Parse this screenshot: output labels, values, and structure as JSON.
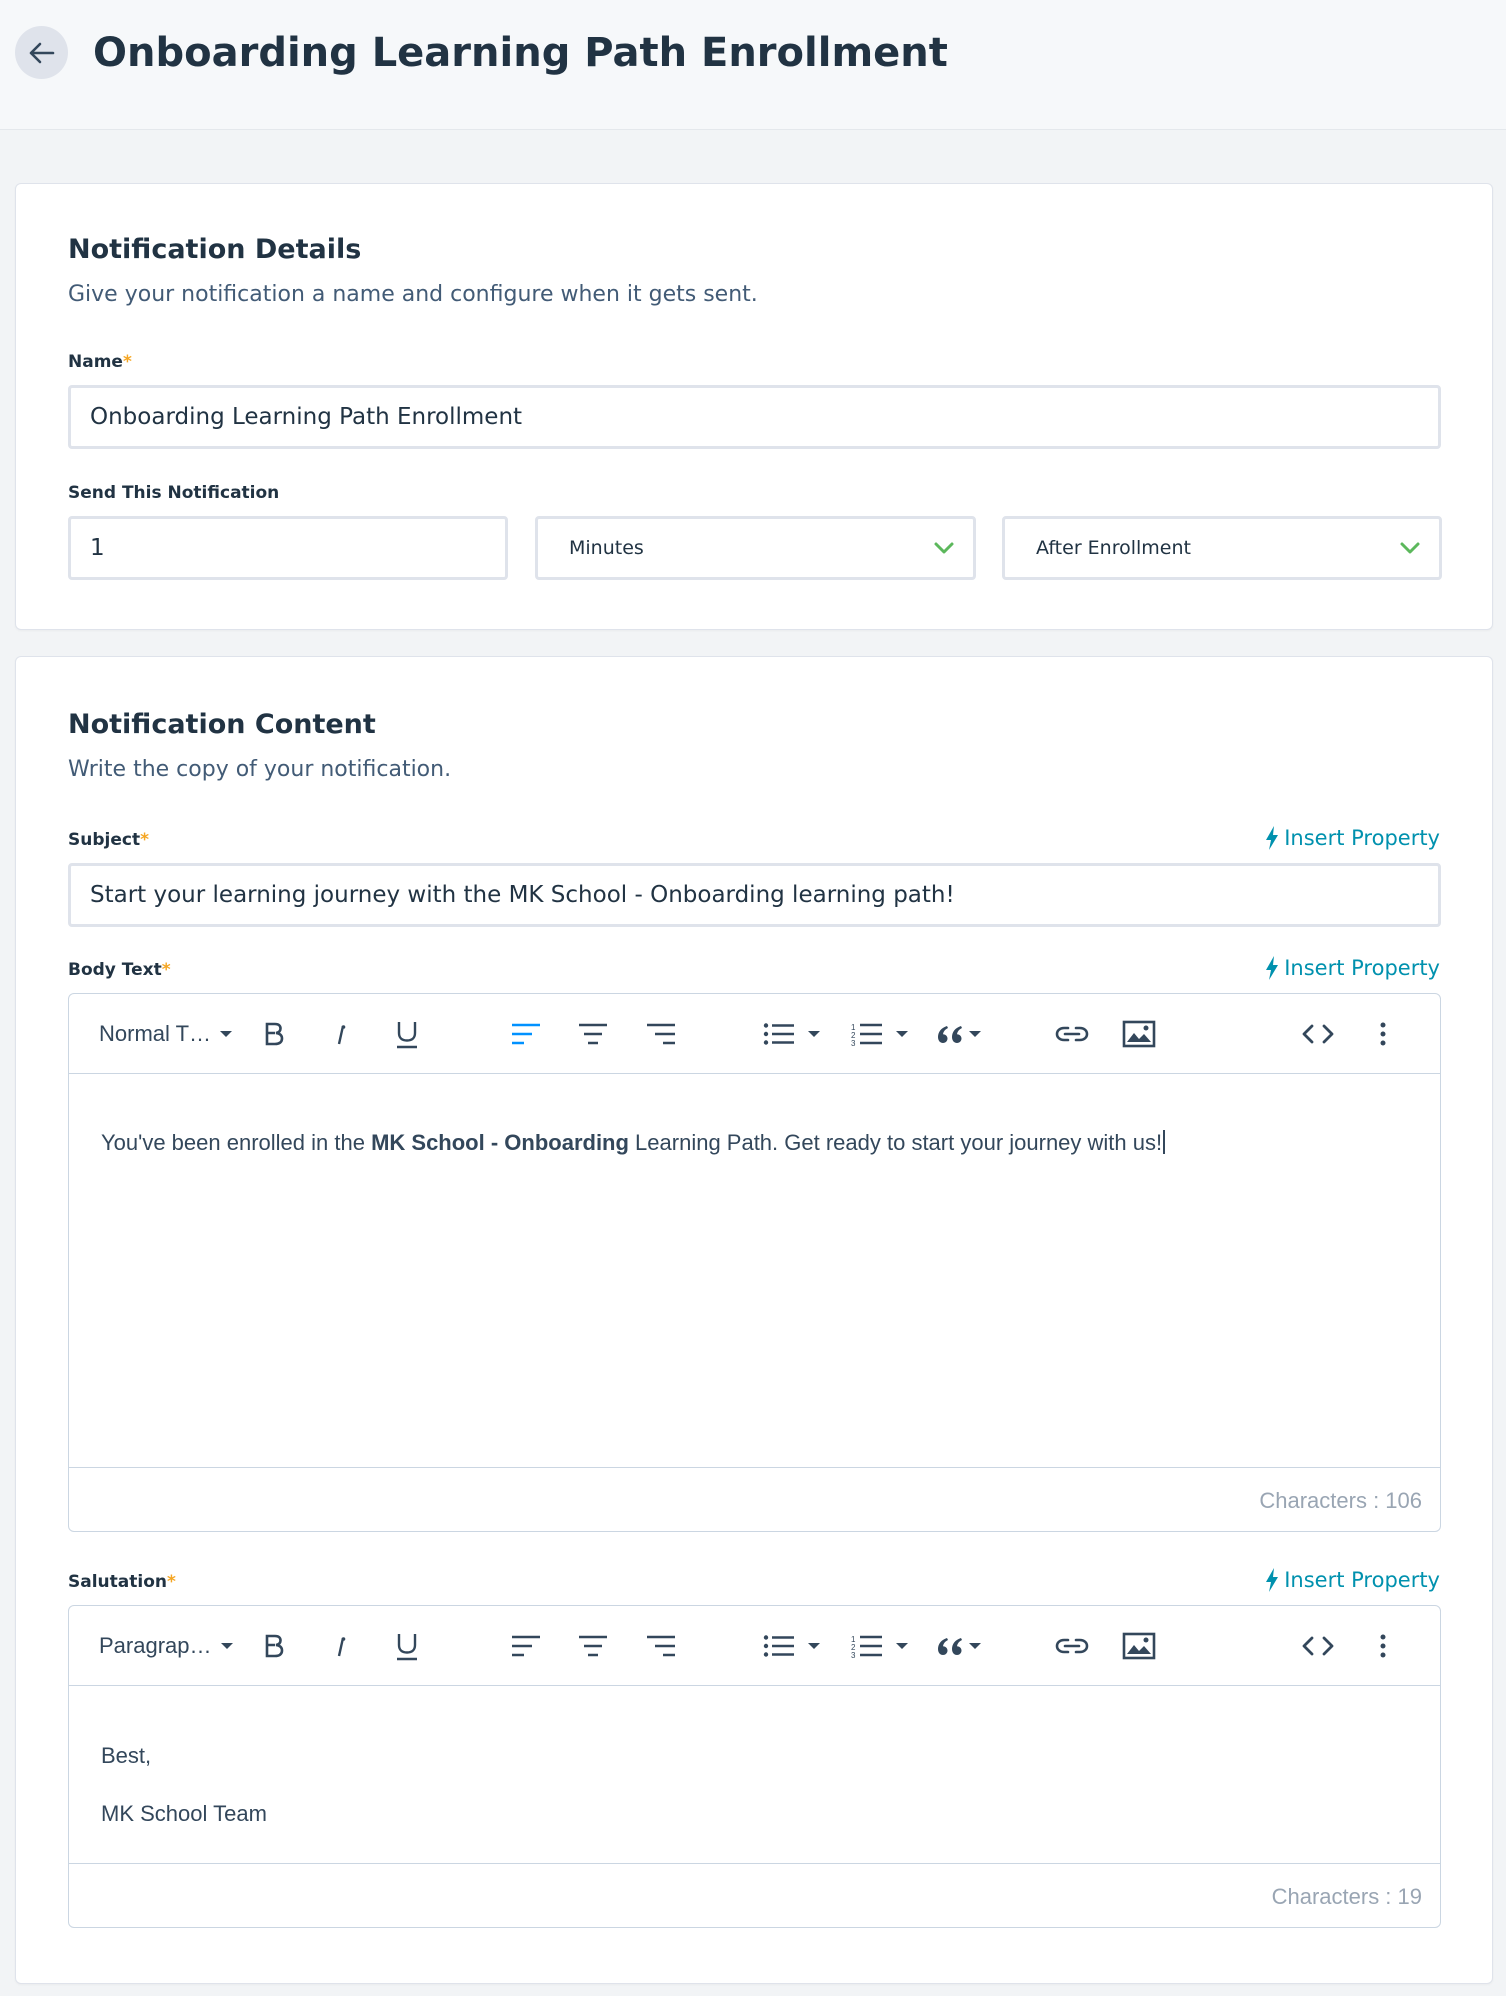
{
  "header": {
    "title": "Onboarding Learning Path Enrollment"
  },
  "details": {
    "title": "Notification Details",
    "subtitle": "Give your notification a name and configure when it gets sent.",
    "name_label": "Name",
    "name_value": "Onboarding Learning Path Enrollment",
    "send_label": "Send This Notification",
    "send_amount": "1",
    "send_unit": "Minutes",
    "send_trigger": "After Enrollment"
  },
  "content": {
    "title": "Notification Content",
    "subtitle": "Write the copy of your notification.",
    "insert_property": "Insert Property",
    "subject_label": "Subject",
    "subject_value": "Start your learning journey with the MK School - Onboarding learning path!",
    "body_label": "Body Text",
    "body_style": "Normal T…",
    "body_text_before": "You've been enrolled in the ",
    "body_text_bold": "MK School - Onboarding",
    "body_text_after": " Learning Path. Get ready to start your journey with us!",
    "body_char_count": "Characters : 106",
    "salutation_label": "Salutation",
    "salutation_style": "Paragrap…",
    "salutation_line1": "Best,",
    "salutation_line2": "MK School Team",
    "salutation_char_count": "Characters : 19"
  },
  "colors": {
    "accent": "#0091ae",
    "active_align": "#0091ff",
    "chevron": "#5cb85c",
    "required": "#f5a623"
  }
}
